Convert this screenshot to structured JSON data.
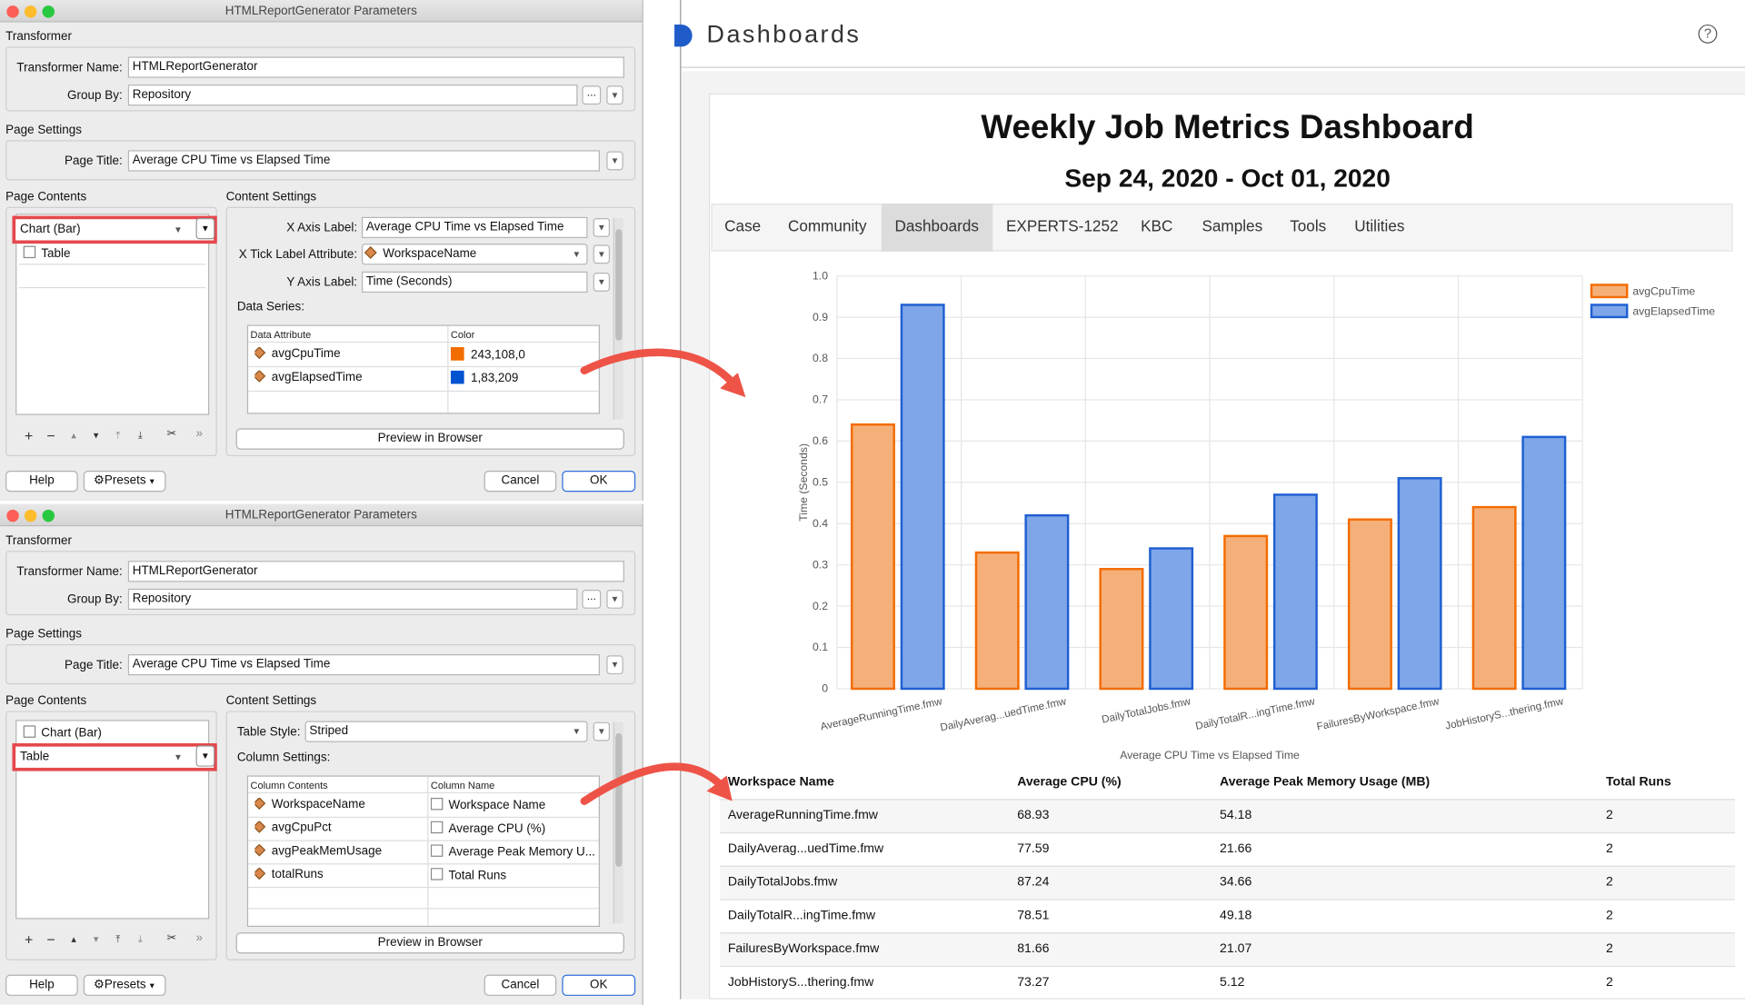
{
  "dialog": {
    "title": "HTMLReportGenerator Parameters",
    "transformer_section": "Transformer",
    "transformer_name_label": "Transformer Name:",
    "transformer_name": "HTMLReportGenerator",
    "group_by_label": "Group By:",
    "group_by": "Repository",
    "page_settings_section": "Page Settings",
    "page_title_label": "Page Title:",
    "page_title": "Average CPU Time vs Elapsed Time",
    "page_contents_section": "Page Contents",
    "content_settings_section": "Content Settings",
    "preview_button": "Preview in Browser",
    "help_button": "Help",
    "presets_button": "Presets",
    "cancel_button": "Cancel",
    "ok_button": "OK",
    "ellipsis": "...",
    "toolbar": [
      "+",
      "−",
      "▴",
      "▾",
      "⤒",
      "⤓",
      "✂",
      "»"
    ]
  },
  "dialog1": {
    "contents_items": [
      "Chart (Bar)",
      "Table"
    ],
    "x_axis_label_label": "X Axis Label:",
    "x_axis_label": "Average CPU Time vs Elapsed Time",
    "x_tick_label": "X Tick Label Attribute:",
    "x_tick_attr": "WorkspaceName",
    "y_axis_label_label": "Y Axis Label:",
    "y_axis_label": "Time (Seconds)",
    "data_series_label": "Data Series:",
    "col_attr": "Data Attribute",
    "col_color": "Color",
    "series": [
      {
        "attr": "avgCpuTime",
        "color": "243,108,0",
        "hex": "#f36c00"
      },
      {
        "attr": "avgElapsedTime",
        "color": "1,83,209",
        "hex": "#0153d1"
      }
    ]
  },
  "dialog2": {
    "contents_items": [
      "Chart (Bar)",
      "Table"
    ],
    "table_style_label": "Table Style:",
    "table_style": "Striped",
    "column_settings_label": "Column Settings:",
    "col_contents": "Column Contents",
    "col_name": "Column Name",
    "columns": [
      {
        "attr": "WorkspaceName",
        "name": "Workspace Name"
      },
      {
        "attr": "avgCpuPct",
        "name": "Average CPU (%)"
      },
      {
        "attr": "avgPeakMemUsage",
        "name": "Average Peak Memory U..."
      },
      {
        "attr": "totalRuns",
        "name": "Total Runs"
      }
    ]
  },
  "dashboard": {
    "header": "Dashboards",
    "help_icon": "?",
    "title": "Weekly Job Metrics Dashboard",
    "date_range": "Sep 24, 2020 - Oct 01, 2020",
    "tabs": [
      "Case",
      "Community",
      "Dashboards",
      "EXPERTS-1252",
      "KBC",
      "Samples",
      "Tools",
      "Utilities"
    ],
    "active_tab": "Dashboards",
    "table": {
      "headers": [
        "Workspace Name",
        "Average CPU (%)",
        "Average Peak Memory Usage (MB)",
        "Total Runs"
      ],
      "rows": [
        [
          "AverageRunningTime.fmw",
          "68.93",
          "54.18",
          "2"
        ],
        [
          "DailyAverag...uedTime.fmw",
          "77.59",
          "21.66",
          "2"
        ],
        [
          "DailyTotalJobs.fmw",
          "87.24",
          "34.66",
          "2"
        ],
        [
          "DailyTotalR...ingTime.fmw",
          "78.51",
          "49.18",
          "2"
        ],
        [
          "FailuresByWorkspace.fmw",
          "81.66",
          "21.07",
          "2"
        ],
        [
          "JobHistoryS...thering.fmw",
          "73.27",
          "5.12",
          "2"
        ]
      ]
    }
  },
  "chart_data": {
    "type": "bar",
    "categories": [
      "AverageRunningTime.fmw",
      "DailyAverag...uedTime.fmw",
      "DailyTotalJobs.fmw",
      "DailyTotalR...ingTime.fmw",
      "FailuresByWorkspace.fmw",
      "JobHistoryS...thering.fmw"
    ],
    "series": [
      {
        "name": "avgCpuTime",
        "values": [
          0.64,
          0.33,
          0.29,
          0.37,
          0.41,
          0.44
        ],
        "fill": "#f5b07a",
        "stroke": "#f36c00"
      },
      {
        "name": "avgElapsedTime",
        "values": [
          0.93,
          0.42,
          0.34,
          0.47,
          0.51,
          0.61
        ],
        "fill": "#7ea6e8",
        "stroke": "#1f5fd1"
      }
    ],
    "xlabel": "Average CPU Time vs Elapsed Time",
    "ylabel": "Time (Seconds)",
    "ylim": [
      0,
      1.0
    ],
    "yticks": [
      "0",
      "0.1",
      "0.2",
      "0.3",
      "0.4",
      "0.5",
      "0.6",
      "0.7",
      "0.8",
      "0.9",
      "1.0"
    ],
    "legend": "top-right",
    "grid": true
  }
}
